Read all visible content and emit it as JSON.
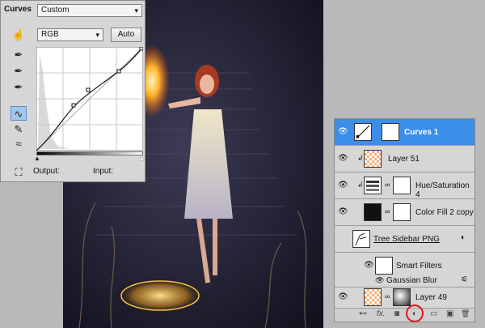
{
  "curves_panel": {
    "title": "Curves",
    "preset": "Custom",
    "channel": "RGB",
    "auto_label": "Auto",
    "output_label": "Output:",
    "input_label": "Input:"
  },
  "layers": [
    {
      "name": "Curves 1",
      "selected": true,
      "icon": "curves-adjustment-icon"
    },
    {
      "name": "Layer 51",
      "selected": false,
      "icon": "transparent-thumbnail"
    },
    {
      "name": "Hue/Saturation 4",
      "selected": false,
      "icon": "hue-saturation-icon"
    },
    {
      "name": "Color Fill 2 copy",
      "selected": false,
      "icon": "color-fill-thumbnail"
    },
    {
      "name": "Tree Sidebar PNG",
      "selected": false,
      "icon": "smart-object-thumbnail"
    },
    {
      "name": "Smart Filters",
      "selected": false,
      "icon": "filter-mask-thumbnail"
    },
    {
      "name": "Gaussian Blur",
      "selected": false,
      "icon": "filter-icon"
    },
    {
      "name": "Layer 49",
      "selected": false,
      "icon": "transparent-thumbnail"
    }
  ],
  "footer": {
    "link": "⊷",
    "fx": "fx.",
    "mask": "◙",
    "adjustment": "◐",
    "group": "▭",
    "new": "▣",
    "trash": "🗑"
  },
  "colors": {
    "selected_row": "#3b8ee8",
    "highlight_circle": "#e0141e"
  }
}
